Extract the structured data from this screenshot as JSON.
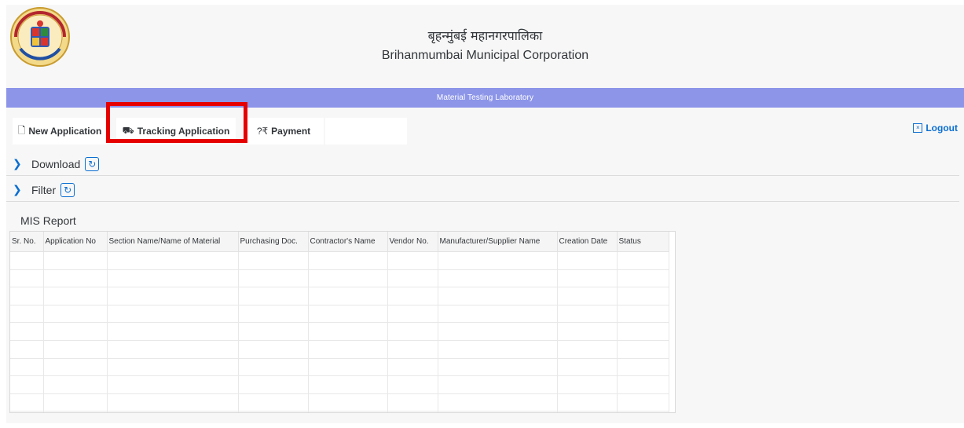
{
  "header": {
    "title_hindi": "बृहन्मुंबई महानगरपालिका",
    "title_english": "Brihanmumbai Municipal Corporation",
    "logo_icon": "bmc-emblem-logo"
  },
  "banner": {
    "text": "Material Testing Laboratory",
    "color": "#8c95e8"
  },
  "toolbar": {
    "new_application": "New Application",
    "tracking_application": "Tracking Application",
    "payment": "Payment",
    "logout": "Logout",
    "icons": {
      "new_application": "document-icon",
      "tracking_application": "truck-icon",
      "payment": "payment-icon",
      "logout": "close-box-icon"
    }
  },
  "sections": {
    "download": "Download",
    "filter": "Filter"
  },
  "report": {
    "title": "MIS Report",
    "columns": [
      "Sr. No.",
      "Application No",
      "Section Name/Name of Material",
      "Purchasing Doc.",
      "Contractor's Name",
      "Vendor No.",
      "Manufacturer/Supplier Name",
      "Creation Date",
      "Status"
    ],
    "rows": []
  },
  "colors": {
    "accent": "#0a6ed1",
    "highlight": "#e60000"
  }
}
